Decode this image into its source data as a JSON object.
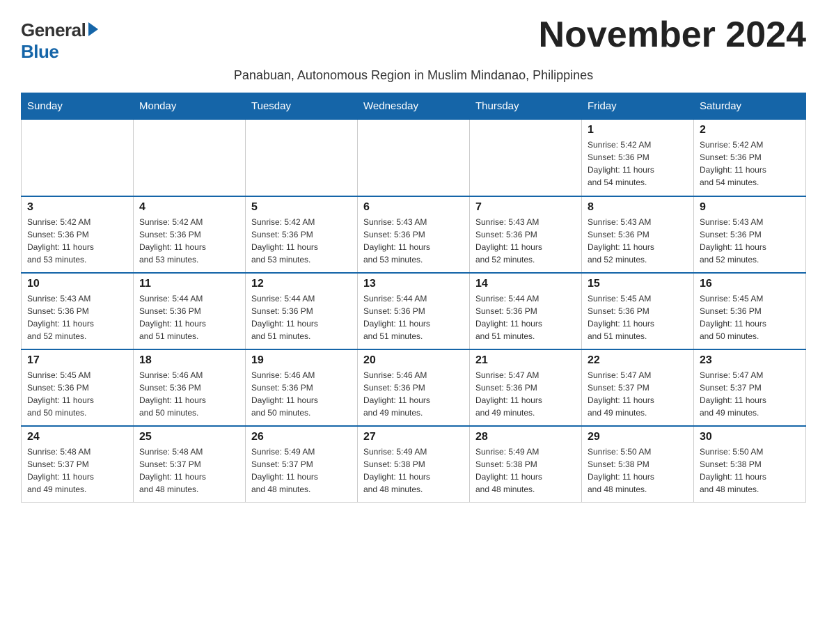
{
  "logo": {
    "general": "General",
    "blue": "Blue"
  },
  "title": "November 2024",
  "subtitle": "Panabuan, Autonomous Region in Muslim Mindanao, Philippines",
  "weekdays": [
    "Sunday",
    "Monday",
    "Tuesday",
    "Wednesday",
    "Thursday",
    "Friday",
    "Saturday"
  ],
  "weeks": [
    [
      {
        "day": "",
        "info": ""
      },
      {
        "day": "",
        "info": ""
      },
      {
        "day": "",
        "info": ""
      },
      {
        "day": "",
        "info": ""
      },
      {
        "day": "",
        "info": ""
      },
      {
        "day": "1",
        "info": "Sunrise: 5:42 AM\nSunset: 5:36 PM\nDaylight: 11 hours\nand 54 minutes."
      },
      {
        "day": "2",
        "info": "Sunrise: 5:42 AM\nSunset: 5:36 PM\nDaylight: 11 hours\nand 54 minutes."
      }
    ],
    [
      {
        "day": "3",
        "info": "Sunrise: 5:42 AM\nSunset: 5:36 PM\nDaylight: 11 hours\nand 53 minutes."
      },
      {
        "day": "4",
        "info": "Sunrise: 5:42 AM\nSunset: 5:36 PM\nDaylight: 11 hours\nand 53 minutes."
      },
      {
        "day": "5",
        "info": "Sunrise: 5:42 AM\nSunset: 5:36 PM\nDaylight: 11 hours\nand 53 minutes."
      },
      {
        "day": "6",
        "info": "Sunrise: 5:43 AM\nSunset: 5:36 PM\nDaylight: 11 hours\nand 53 minutes."
      },
      {
        "day": "7",
        "info": "Sunrise: 5:43 AM\nSunset: 5:36 PM\nDaylight: 11 hours\nand 52 minutes."
      },
      {
        "day": "8",
        "info": "Sunrise: 5:43 AM\nSunset: 5:36 PM\nDaylight: 11 hours\nand 52 minutes."
      },
      {
        "day": "9",
        "info": "Sunrise: 5:43 AM\nSunset: 5:36 PM\nDaylight: 11 hours\nand 52 minutes."
      }
    ],
    [
      {
        "day": "10",
        "info": "Sunrise: 5:43 AM\nSunset: 5:36 PM\nDaylight: 11 hours\nand 52 minutes."
      },
      {
        "day": "11",
        "info": "Sunrise: 5:44 AM\nSunset: 5:36 PM\nDaylight: 11 hours\nand 51 minutes."
      },
      {
        "day": "12",
        "info": "Sunrise: 5:44 AM\nSunset: 5:36 PM\nDaylight: 11 hours\nand 51 minutes."
      },
      {
        "day": "13",
        "info": "Sunrise: 5:44 AM\nSunset: 5:36 PM\nDaylight: 11 hours\nand 51 minutes."
      },
      {
        "day": "14",
        "info": "Sunrise: 5:44 AM\nSunset: 5:36 PM\nDaylight: 11 hours\nand 51 minutes."
      },
      {
        "day": "15",
        "info": "Sunrise: 5:45 AM\nSunset: 5:36 PM\nDaylight: 11 hours\nand 51 minutes."
      },
      {
        "day": "16",
        "info": "Sunrise: 5:45 AM\nSunset: 5:36 PM\nDaylight: 11 hours\nand 50 minutes."
      }
    ],
    [
      {
        "day": "17",
        "info": "Sunrise: 5:45 AM\nSunset: 5:36 PM\nDaylight: 11 hours\nand 50 minutes."
      },
      {
        "day": "18",
        "info": "Sunrise: 5:46 AM\nSunset: 5:36 PM\nDaylight: 11 hours\nand 50 minutes."
      },
      {
        "day": "19",
        "info": "Sunrise: 5:46 AM\nSunset: 5:36 PM\nDaylight: 11 hours\nand 50 minutes."
      },
      {
        "day": "20",
        "info": "Sunrise: 5:46 AM\nSunset: 5:36 PM\nDaylight: 11 hours\nand 49 minutes."
      },
      {
        "day": "21",
        "info": "Sunrise: 5:47 AM\nSunset: 5:36 PM\nDaylight: 11 hours\nand 49 minutes."
      },
      {
        "day": "22",
        "info": "Sunrise: 5:47 AM\nSunset: 5:37 PM\nDaylight: 11 hours\nand 49 minutes."
      },
      {
        "day": "23",
        "info": "Sunrise: 5:47 AM\nSunset: 5:37 PM\nDaylight: 11 hours\nand 49 minutes."
      }
    ],
    [
      {
        "day": "24",
        "info": "Sunrise: 5:48 AM\nSunset: 5:37 PM\nDaylight: 11 hours\nand 49 minutes."
      },
      {
        "day": "25",
        "info": "Sunrise: 5:48 AM\nSunset: 5:37 PM\nDaylight: 11 hours\nand 48 minutes."
      },
      {
        "day": "26",
        "info": "Sunrise: 5:49 AM\nSunset: 5:37 PM\nDaylight: 11 hours\nand 48 minutes."
      },
      {
        "day": "27",
        "info": "Sunrise: 5:49 AM\nSunset: 5:38 PM\nDaylight: 11 hours\nand 48 minutes."
      },
      {
        "day": "28",
        "info": "Sunrise: 5:49 AM\nSunset: 5:38 PM\nDaylight: 11 hours\nand 48 minutes."
      },
      {
        "day": "29",
        "info": "Sunrise: 5:50 AM\nSunset: 5:38 PM\nDaylight: 11 hours\nand 48 minutes."
      },
      {
        "day": "30",
        "info": "Sunrise: 5:50 AM\nSunset: 5:38 PM\nDaylight: 11 hours\nand 48 minutes."
      }
    ]
  ]
}
